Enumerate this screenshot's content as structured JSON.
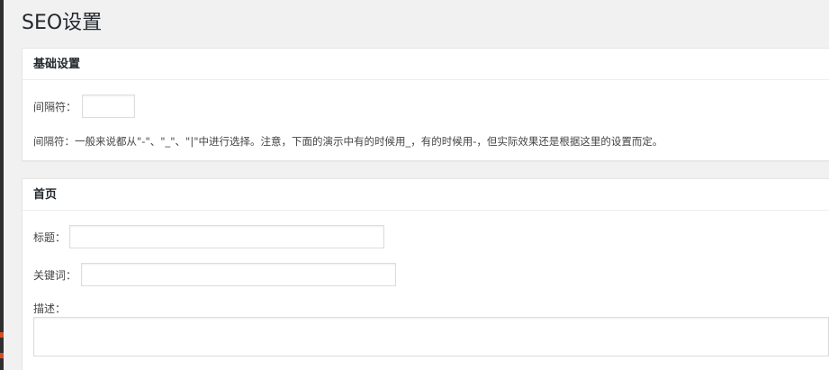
{
  "page": {
    "title": "SEO设置"
  },
  "basic": {
    "heading": "基础设置",
    "separator_label": "间隔符：",
    "separator_value": "",
    "description": "间隔符：一般来说都从\"-\"、\"_\"、\"|\"中进行选择。注意，下面的演示中有的时候用_，有的时候用-，但实际效果还是根据这里的设置而定。"
  },
  "home": {
    "heading": "首页",
    "title_label": "标题：",
    "title_value": "",
    "keywords_label": "关键词：",
    "keywords_value": "",
    "description_label": "描述：",
    "description_value": ""
  }
}
